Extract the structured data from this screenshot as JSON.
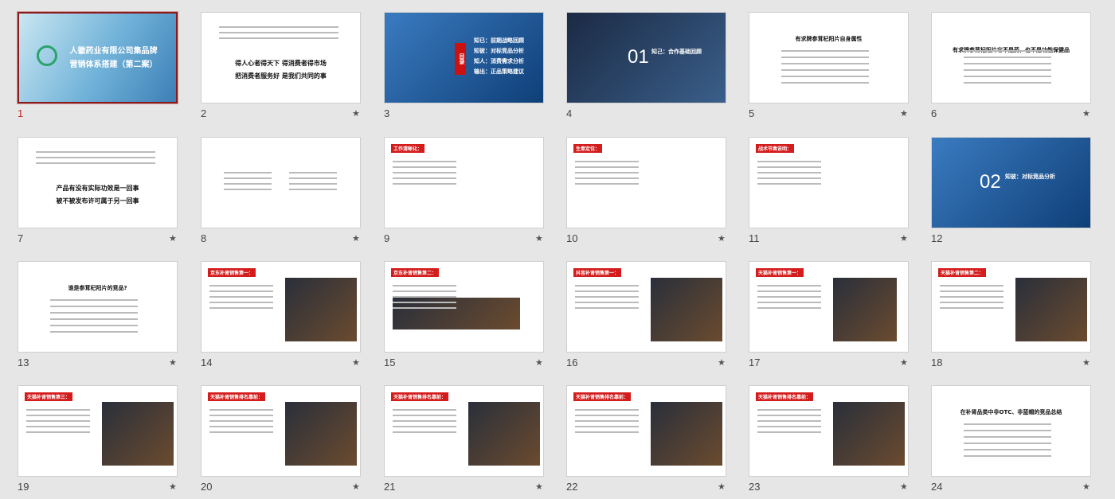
{
  "slides": [
    {
      "num": "1",
      "title_line1": "人徽药业有限公司集品牌",
      "title_line2": "营销体系搭建（第二案）",
      "starred": false
    },
    {
      "num": "2",
      "line1": "得人心者得天下  得消费者得市场",
      "line2": "把消费者服务好  是我们共同的事",
      "starred": true
    },
    {
      "num": "3",
      "toc_label": "目录",
      "toc_items": [
        "知已：前期战略回顾",
        "知彼：对标竞品分析",
        "知人：消费需求分析",
        "输出：正品策略建议"
      ],
      "starred": false
    },
    {
      "num": "4",
      "big_num": "01",
      "subtitle": "知己：合作基础回顾",
      "starred": false
    },
    {
      "num": "5",
      "heading": "有求牌参茸杞阳片自身属性",
      "starred": true
    },
    {
      "num": "6",
      "heading": "有求牌参茸杞阳片它不是药，也不是功能保健品",
      "starred": true
    },
    {
      "num": "7",
      "line1": "产品有没有实际功效是一回事",
      "line2": "被不被发布许可属于另一回事",
      "starred": true
    },
    {
      "num": "8",
      "starred": true
    },
    {
      "num": "9",
      "header": "工作清晰化：",
      "starred": true
    },
    {
      "num": "10",
      "header": "生意定位：",
      "starred": true
    },
    {
      "num": "11",
      "header": "战术节奏说明：",
      "starred": true
    },
    {
      "num": "12",
      "big_num": "02",
      "subtitle": "知彼：对标竞品分析",
      "starred": false
    },
    {
      "num": "13",
      "heading": "谁是参茸杞阳片的竞品?",
      "starred": true
    },
    {
      "num": "14",
      "header": "京东补肾销售第一：",
      "starred": true
    },
    {
      "num": "15",
      "header": "京东补肾销售第二：",
      "starred": true
    },
    {
      "num": "16",
      "header": "抖音补肾销售第一：",
      "starred": true
    },
    {
      "num": "17",
      "header": "天猫补肾销售第一：",
      "starred": true
    },
    {
      "num": "18",
      "header": "天猫补肾销售第二：",
      "starred": true
    },
    {
      "num": "19",
      "header": "天猫补肾销售第三：",
      "starred": true
    },
    {
      "num": "20",
      "header": "天猫补肾销售排名靠前：",
      "starred": true
    },
    {
      "num": "21",
      "header": "天猫补肾销售排名靠前：",
      "starred": true
    },
    {
      "num": "22",
      "header": "天猫补肾销售排名靠前：",
      "starred": true
    },
    {
      "num": "23",
      "header": "天猫补肾销售排名靠前：",
      "starred": true
    },
    {
      "num": "24",
      "heading": "在补肾品类中非OTC、非蓝帽的竞品总结",
      "starred": true
    }
  ],
  "star_glyph": "★"
}
